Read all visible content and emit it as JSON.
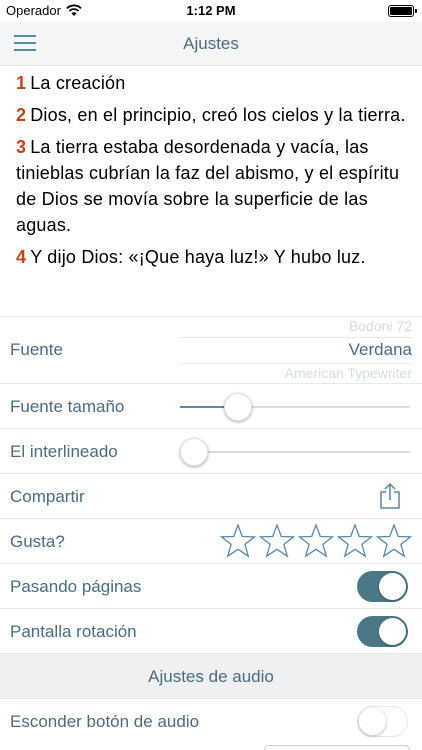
{
  "status_bar": {
    "carrier": "Operador",
    "time": "1:12 PM"
  },
  "nav": {
    "title": "Ajustes",
    "menu_icon": "hamburger-menu-icon"
  },
  "verses": [
    {
      "num": "1",
      "text": "La creación"
    },
    {
      "num": "2",
      "text": "Dios, en el principio, creó los cielos y la tierra."
    },
    {
      "num": "3",
      "text": "La tierra estaba desordenada y vacía, las tinieblas cubrían la faz del abismo, y el espíritu de Dios se movía sobre la superficie de las aguas."
    },
    {
      "num": "4",
      "text": "Y dijo Dios: «¡Que haya luz!» Y hubo luz."
    }
  ],
  "settings": {
    "font": {
      "label": "Fuente",
      "options": [
        "Bodoni 72",
        "Verdana",
        "American Typewriter"
      ],
      "selected": "Verdana"
    },
    "font_size": {
      "label": "Fuente tamaño",
      "value_fraction": 0.25
    },
    "line_spacing": {
      "label": "El interlineado",
      "value_fraction": 0.06
    },
    "share": {
      "label": "Compartir",
      "icon": "share-icon"
    },
    "rating": {
      "label": "Gusta?",
      "max": 5,
      "value": 0,
      "icon": "star-outline-icon"
    },
    "page_turn": {
      "label": "Pasando páginas",
      "on": true
    },
    "screen_rotation": {
      "label": "Pantalla rotación",
      "on": true
    },
    "audio_section_title": "Ajustes de audio",
    "hide_audio_button": {
      "label": "Esconder botón de audio",
      "on": false
    }
  },
  "colors": {
    "accent": "#5a8aa4",
    "toggle_on": "#4b7889",
    "verse_number": "#c0451c",
    "label_text": "#4b6b80"
  }
}
